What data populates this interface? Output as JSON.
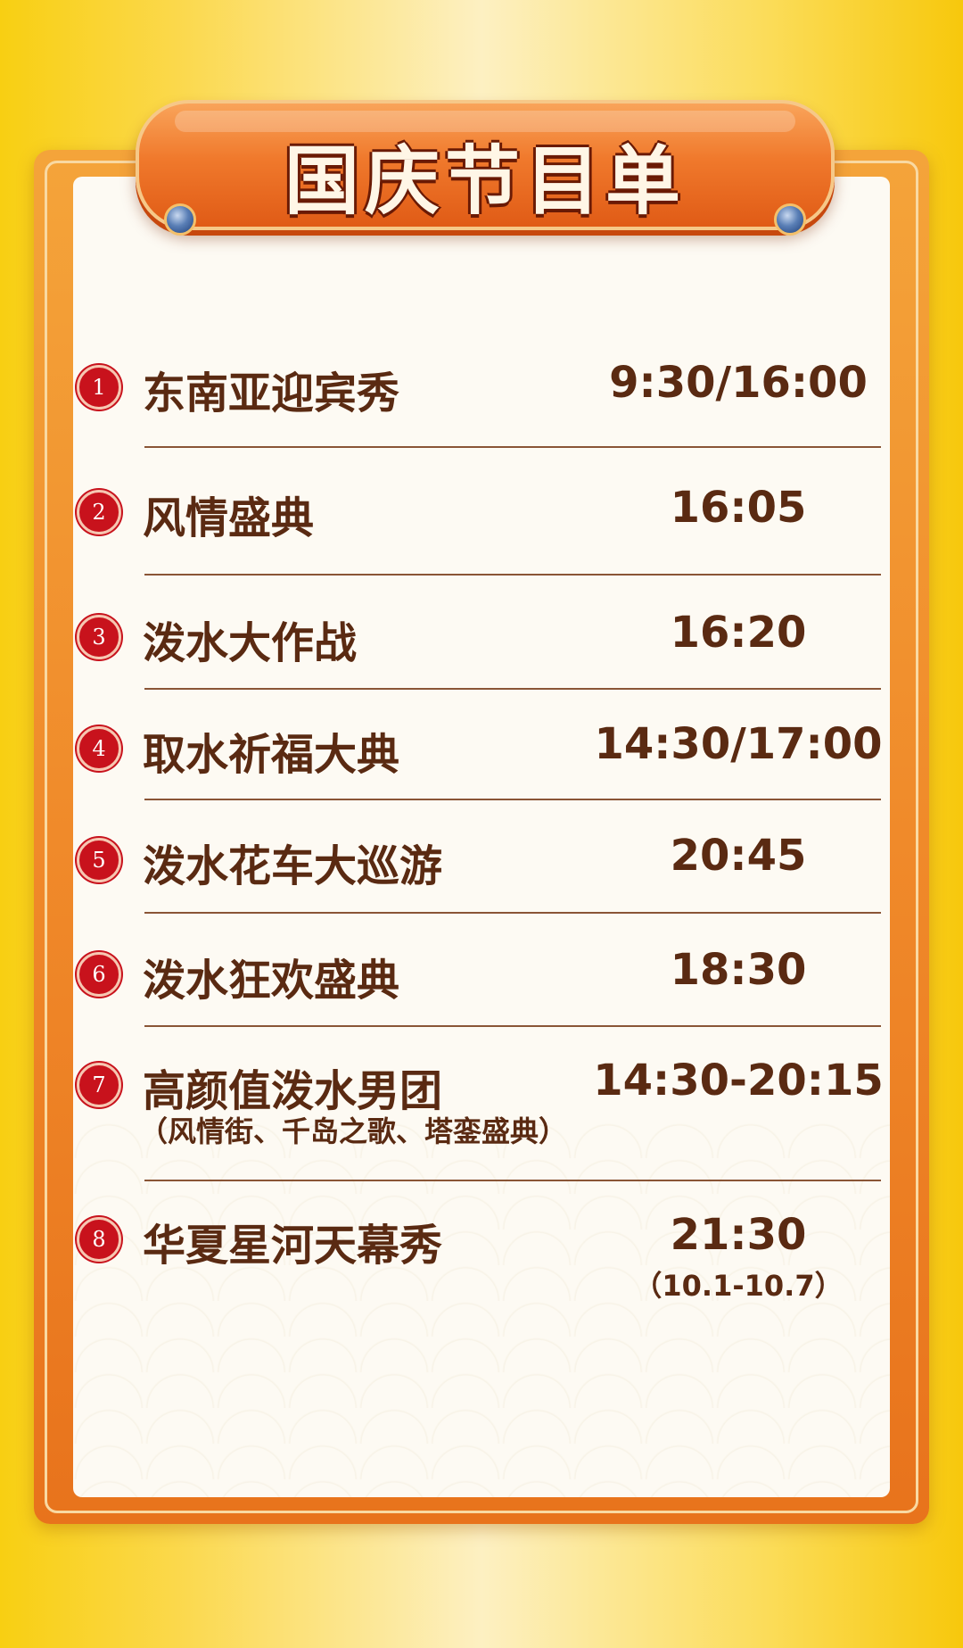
{
  "title": "国庆节目单",
  "programs": [
    {
      "number": "1",
      "name": "东南亚迎宾秀",
      "sub": "",
      "time": "9:30/16:00",
      "time_sub": ""
    },
    {
      "number": "2",
      "name": "风情盛典",
      "sub": "",
      "time": "16:05",
      "time_sub": ""
    },
    {
      "number": "3",
      "name": "泼水大作战",
      "sub": "",
      "time": "16:20",
      "time_sub": ""
    },
    {
      "number": "4",
      "name": "取水祈福大典",
      "sub": "",
      "time": "14:30/17:00",
      "time_sub": ""
    },
    {
      "number": "5",
      "name": "泼水花车大巡游",
      "sub": "",
      "time": "20:45",
      "time_sub": ""
    },
    {
      "number": "6",
      "name": "泼水狂欢盛典",
      "sub": "",
      "time": "18:30",
      "time_sub": ""
    },
    {
      "number": "7",
      "name": "高颜值泼水男团",
      "sub": "（风情街、千岛之歌、塔銮盛典）",
      "time": "14:30-20:15",
      "time_sub": ""
    },
    {
      "number": "8",
      "name": "华夏星河天幕秀",
      "sub": "",
      "time": "21:30",
      "time_sub": "（10.1-10.7）"
    }
  ],
  "colors": {
    "background": "#f8cf12",
    "frame": "#f08a2a",
    "panel": "#fdfaf3",
    "text": "#5a2a12",
    "badge": "#c8121c"
  }
}
